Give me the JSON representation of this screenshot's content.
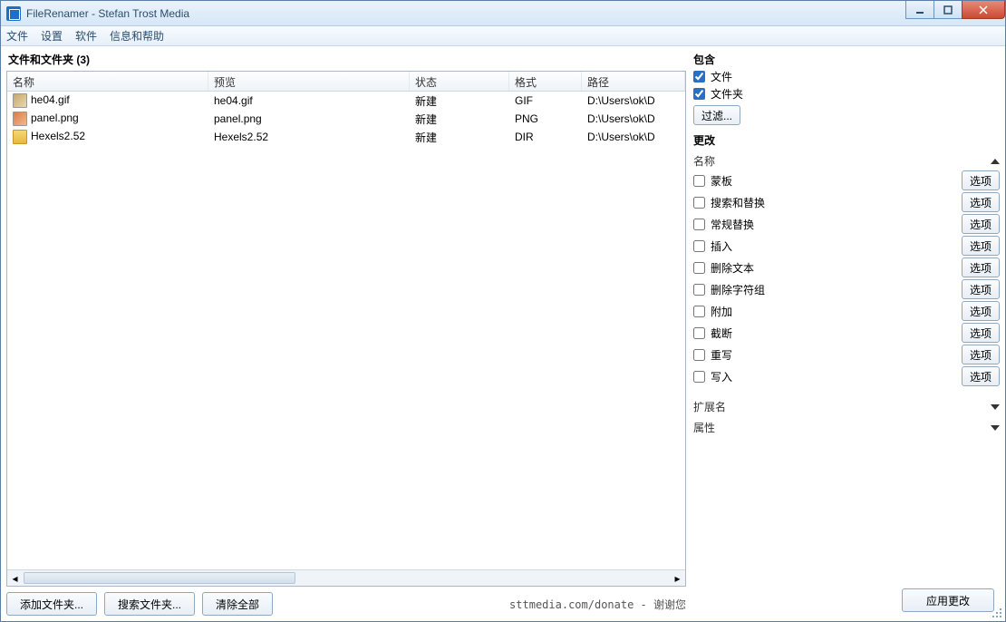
{
  "window": {
    "title": "FileRenamer - Stefan Trost Media"
  },
  "menu": {
    "file": "文件",
    "settings": "设置",
    "software": "软件",
    "help": "信息和帮助"
  },
  "left": {
    "panel_title": "文件和文件夹  (3)",
    "headers": {
      "name": "名称",
      "preview": "预览",
      "status": "状态",
      "format": "格式",
      "path": "路径"
    },
    "rows": [
      {
        "name": "he04.gif",
        "preview": "he04.gif",
        "status": "新建",
        "format": "GIF",
        "path": "D:\\Users\\ok\\D",
        "icon": "gif"
      },
      {
        "name": "panel.png",
        "preview": "panel.png",
        "status": "新建",
        "format": "PNG",
        "path": "D:\\Users\\ok\\D",
        "icon": "png"
      },
      {
        "name": "Hexels2.52",
        "preview": "Hexels2.52",
        "status": "新建",
        "format": "DIR",
        "path": "D:\\Users\\ok\\D",
        "icon": "dir"
      }
    ],
    "buttons": {
      "add_folder": "添加文件夹...",
      "search_folder": "搜索文件夹...",
      "clear_all": "清除全部"
    },
    "donate": "sttmedia.com/donate - 谢谢您"
  },
  "right": {
    "include": {
      "title": "包含",
      "files": "文件",
      "folders": "文件夹",
      "filter": "过滤..."
    },
    "change": {
      "title": "更改",
      "name_section": "名称",
      "options": [
        {
          "label": "蒙板"
        },
        {
          "label": "搜索和替换"
        },
        {
          "label": "常规替换"
        },
        {
          "label": "插入"
        },
        {
          "label": "删除文本"
        },
        {
          "label": "删除字符组"
        },
        {
          "label": "附加"
        },
        {
          "label": "截断"
        },
        {
          "label": "重写"
        },
        {
          "label": "写入"
        }
      ],
      "option_btn": "选项",
      "ext_section": "扩展名",
      "attr_section": "属性"
    },
    "apply": "应用更改"
  }
}
